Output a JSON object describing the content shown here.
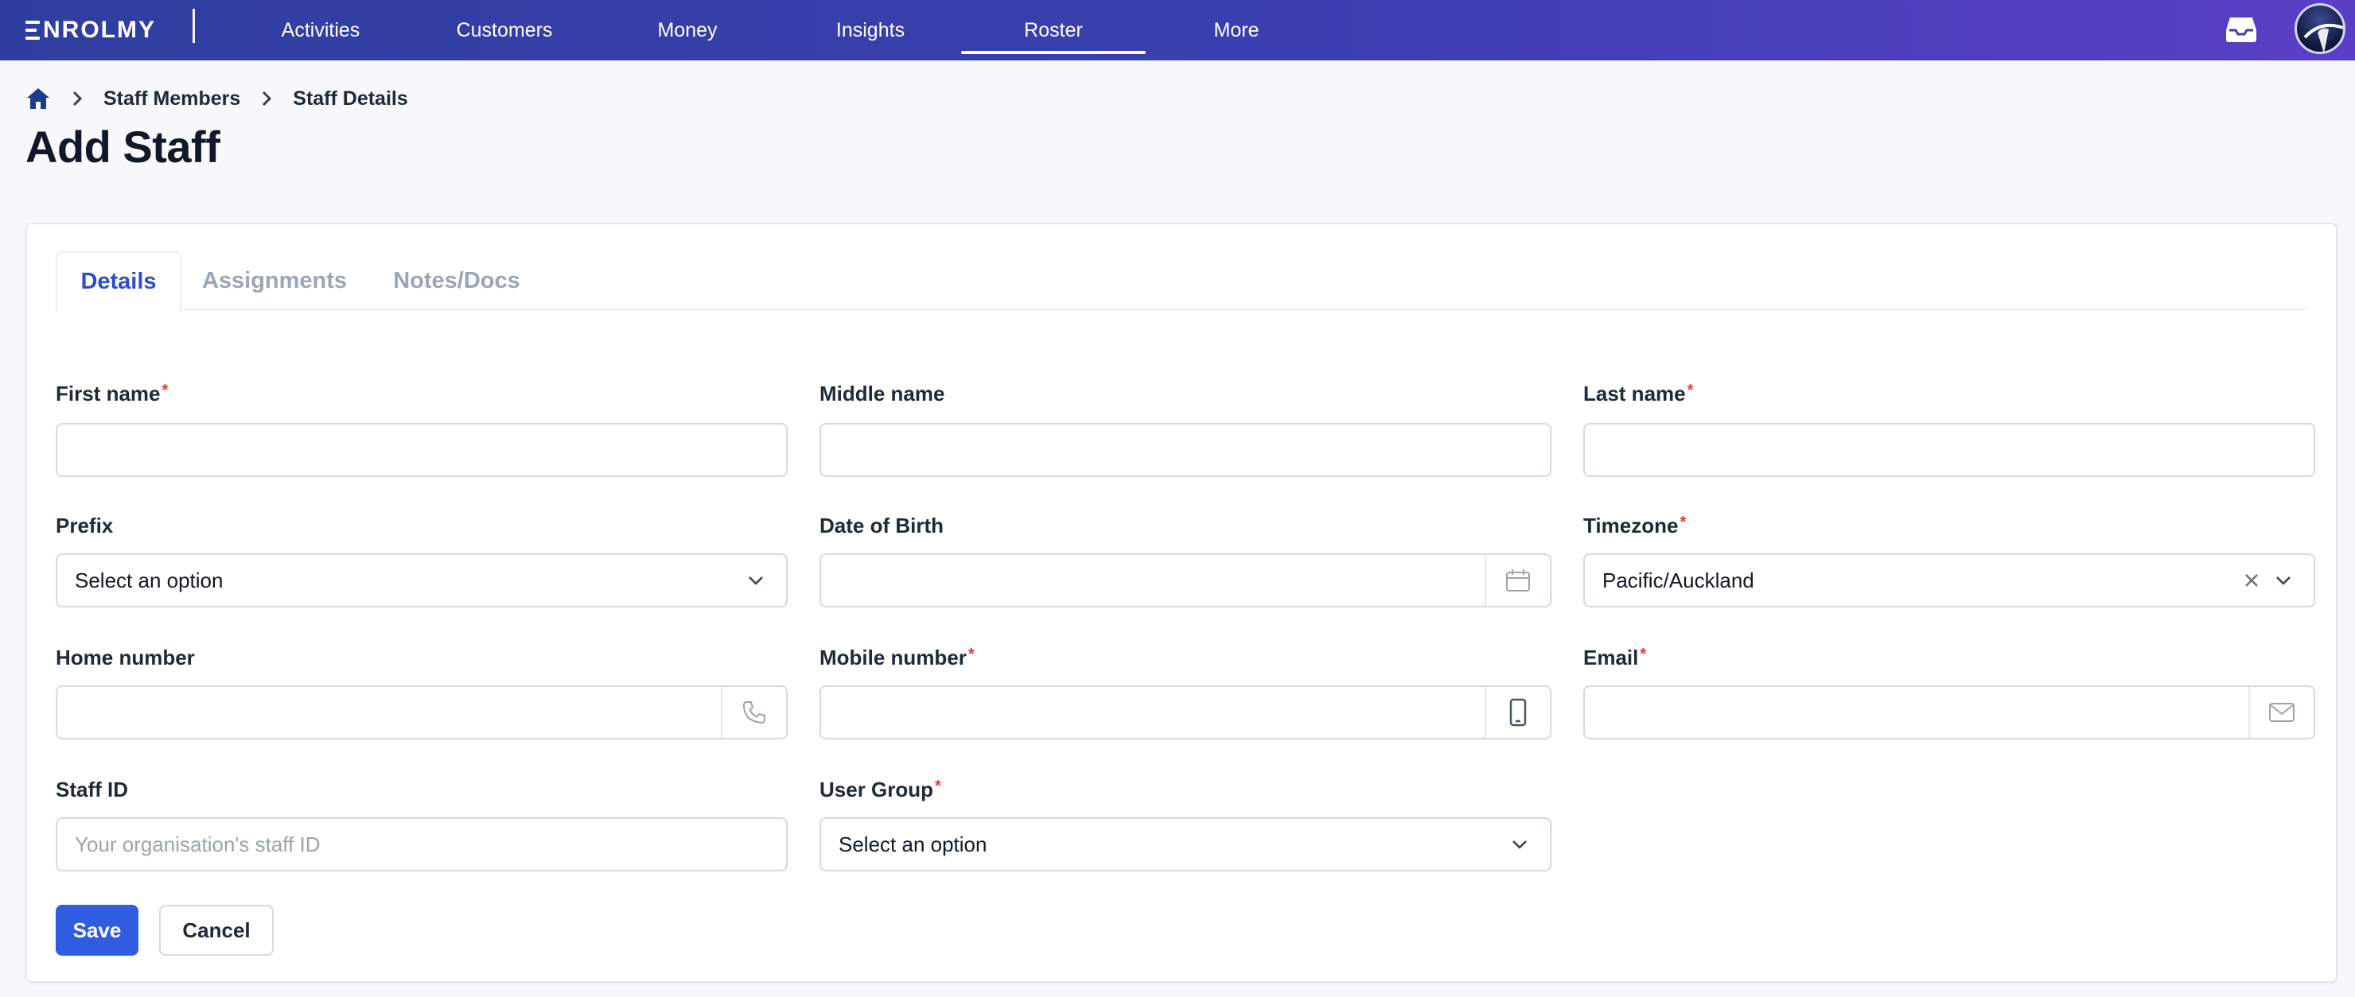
{
  "brand": {
    "name": "NROLMY"
  },
  "nav": {
    "items": [
      {
        "label": "Activities"
      },
      {
        "label": "Customers"
      },
      {
        "label": "Money"
      },
      {
        "label": "Insights"
      },
      {
        "label": "Roster"
      },
      {
        "label": "More"
      }
    ],
    "active": "Roster"
  },
  "breadcrumb": {
    "items": [
      "Staff Members",
      "Staff Details"
    ]
  },
  "page": {
    "title": "Add Staff"
  },
  "tabs": [
    {
      "label": "Details"
    },
    {
      "label": "Assignments"
    },
    {
      "label": "Notes/Docs"
    }
  ],
  "form": {
    "first_name": {
      "label": "First name",
      "required": "*",
      "value": ""
    },
    "middle_name": {
      "label": "Middle name",
      "value": ""
    },
    "last_name": {
      "label": "Last name",
      "required": "*",
      "value": ""
    },
    "prefix": {
      "label": "Prefix",
      "value": "Select an option"
    },
    "dob": {
      "label": "Date of Birth",
      "value": ""
    },
    "timezone": {
      "label": "Timezone",
      "required": "*",
      "value": "Pacific/Auckland"
    },
    "home_number": {
      "label": "Home number",
      "value": ""
    },
    "mobile_number": {
      "label": "Mobile number",
      "required": "*",
      "value": ""
    },
    "email": {
      "label": "Email",
      "required": "*",
      "value": ""
    },
    "staff_id": {
      "label": "Staff ID",
      "placeholder": "Your organisation's staff ID"
    },
    "user_group": {
      "label": "User Group",
      "required": "*",
      "value": "Select an option"
    }
  },
  "actions": {
    "save": "Save",
    "cancel": "Cancel"
  },
  "colors": {
    "primary": "#2f5ce0",
    "nav_start": "#2f3e9e",
    "nav_end": "#5a3fc6",
    "required": "#e53935",
    "tab_active": "#2b4ed1"
  }
}
